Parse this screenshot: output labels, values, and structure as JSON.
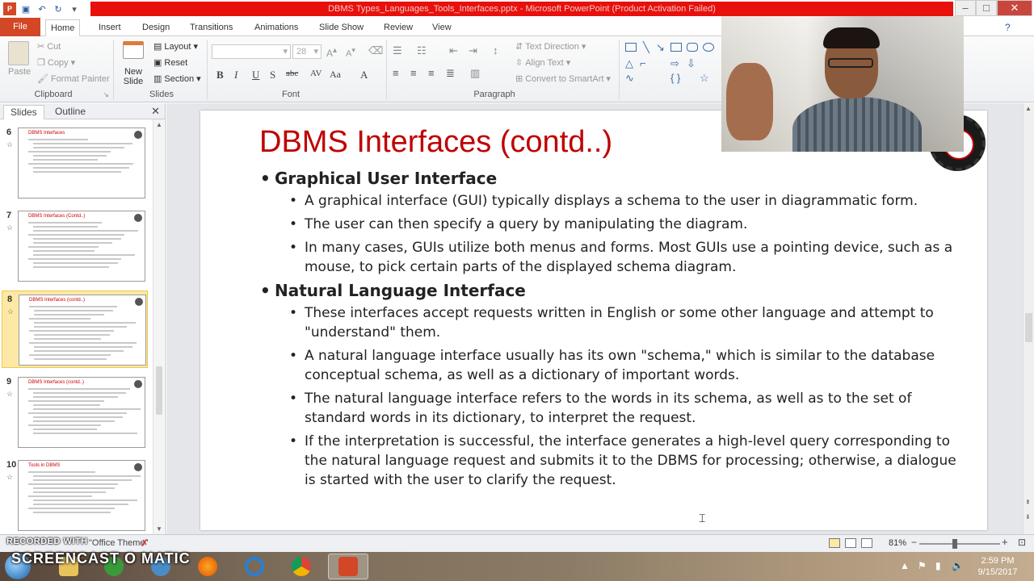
{
  "window": {
    "title": "DBMS Types_Languages_Tools_Interfaces.pptx - Microsoft PowerPoint (Product Activation Failed)",
    "controls": [
      "–",
      "□",
      "✕"
    ]
  },
  "ribbon_tabs": [
    "File",
    "Home",
    "Insert",
    "Design",
    "Transitions",
    "Animations",
    "Slide Show",
    "Review",
    "View"
  ],
  "active_tab": "Home",
  "ribbon": {
    "clipboard": {
      "paste": "Paste",
      "cut": "Cut",
      "copy": "Copy",
      "format_painter": "Format Painter",
      "label": "Clipboard"
    },
    "slides": {
      "new_slide": "New Slide",
      "layout": "Layout",
      "reset": "Reset",
      "section": "Section",
      "label": "Slides"
    },
    "font": {
      "font_name": "",
      "font_size": "28",
      "label": "Font",
      "buttons": [
        "B",
        "I",
        "U",
        "S",
        "abc",
        "AV",
        "Aa",
        "A"
      ]
    },
    "paragraph": {
      "text_direction": "Text Direction",
      "align_text": "Align Text",
      "convert_smartart": "Convert to SmartArt",
      "label": "Paragraph"
    }
  },
  "left_pane": {
    "tabs": [
      "Slides",
      "Outline"
    ],
    "close": "✕",
    "slides": [
      {
        "num": "6",
        "title": "DBMS Interfaces",
        "lines": 9
      },
      {
        "num": "7",
        "title": "DBMS Interfaces (Contd..)",
        "lines": 12
      },
      {
        "num": "8",
        "title": "DBMS Interfaces (contd..)",
        "lines": 14,
        "selected": true
      },
      {
        "num": "9",
        "title": "DBMS Interfaces (contd..)",
        "lines": 12
      },
      {
        "num": "10",
        "title": "Tools in DBMS",
        "lines": 11
      }
    ]
  },
  "slide": {
    "title": "DBMS Interfaces (contd..)",
    "sections": [
      {
        "heading": "Graphical User Interface",
        "bullets": [
          "A graphical interface (GUI) typically displays a schema to the user in diagrammatic form.",
          "The user can then specify a query by manipulating the diagram.",
          "In many cases, GUIs utilize both menus and forms. Most GUIs use a pointing device, such as a mouse, to pick certain parts of the displayed schema diagram."
        ]
      },
      {
        "heading": "Natural Language Interface",
        "bullets": [
          "These interfaces accept requests written in English or some other language and attempt to \"understand\" them.",
          "A natural language interface usually has its own \"schema,\" which is similar to the database conceptual schema, as well as a dictionary of important words.",
          "The natural language interface refers to the words in its schema, as well as to the set of standard words in its dictionary, to interpret the request.",
          "If the interpretation is successful, the interface generates a high-level query corresponding to the natural language request and submits it to the DBMS for processing; otherwise, a dialogue is started with the user to clarify the request."
        ]
      }
    ]
  },
  "status_bar": {
    "theme_text": "\"Office Theme\"",
    "zoom": "81%"
  },
  "watermark": {
    "line1": "RECORDED WITH",
    "line2": "SCREENCAST O MATIC"
  },
  "taskbar": {
    "time": "2:59 PM",
    "date": "9/15/2017"
  }
}
